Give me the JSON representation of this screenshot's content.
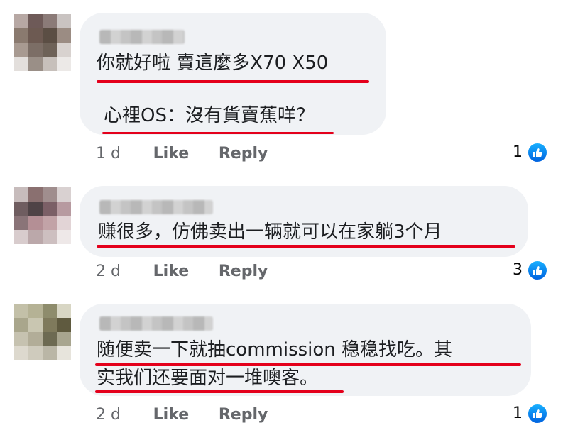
{
  "comments": [
    {
      "lines": [
        "你就好啦 賣這麼多X70 X50",
        "心裡OS：沒有貨賣蕉咩？"
      ],
      "time": "1 d",
      "like_label": "Like",
      "reply_label": "Reply",
      "reaction_count": "1",
      "reaction_icon": "thumbs-up-icon"
    },
    {
      "lines": [
        "赚很多，仿佛卖出一辆就可以在家躺3个月"
      ],
      "time": "2 d",
      "like_label": "Like",
      "reply_label": "Reply",
      "reaction_count": "3",
      "reaction_icon": "thumbs-up-icon"
    },
    {
      "lines": [
        "随便卖一下就抽commission 稳稳找吃。其",
        "实我们还要面对一堆噢客。"
      ],
      "time": "2 d",
      "like_label": "Like",
      "reply_label": "Reply",
      "reaction_count": "1",
      "reaction_icon": "thumbs-up-icon"
    }
  ],
  "colors": {
    "bubble": "#f0f2f5",
    "underline": "#e4001b",
    "meta_text": "#65676b",
    "like_blue": "#0571ed"
  }
}
